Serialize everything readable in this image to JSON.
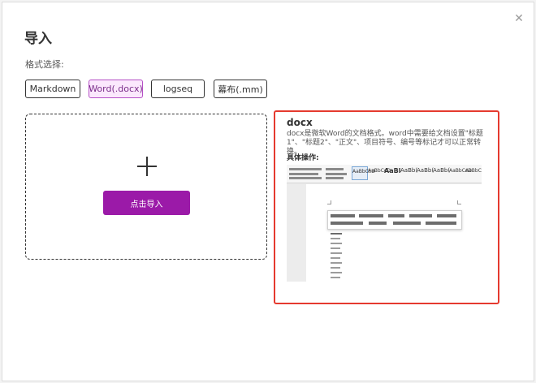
{
  "dialog": {
    "title": "导入",
    "close_icon": "close-icon",
    "format_label": "格式选择:",
    "formats": [
      {
        "label": "Markdown",
        "active": false
      },
      {
        "label": "Word(.docx)",
        "active": true
      },
      {
        "label": "logseq",
        "active": false
      },
      {
        "label": "幕布(.mm)",
        "active": false
      }
    ],
    "dropzone": {
      "plus_icon": "plus-icon",
      "import_label": "点击导入"
    },
    "info": {
      "title": "docx",
      "description": "docx是微软Word的文档格式。word中需要给文档设置\"标题1\"、\"标题2\"、\"正文\"、项目符号、编号等标记才可以正常转换。",
      "ops_label": "具体操作:",
      "preview_styles": [
        "AaBbCcD",
        "AaBbCcD",
        "AaBl",
        "AaBb(",
        "AaBb(",
        "AaBb(",
        "AaBbCcD",
        "AaBbCcD"
      ]
    }
  },
  "colors": {
    "accent": "#9b1aa8",
    "active_border": "#b54fc6",
    "active_bg": "#fbe8fd",
    "highlight_border": "#e53a2f"
  }
}
